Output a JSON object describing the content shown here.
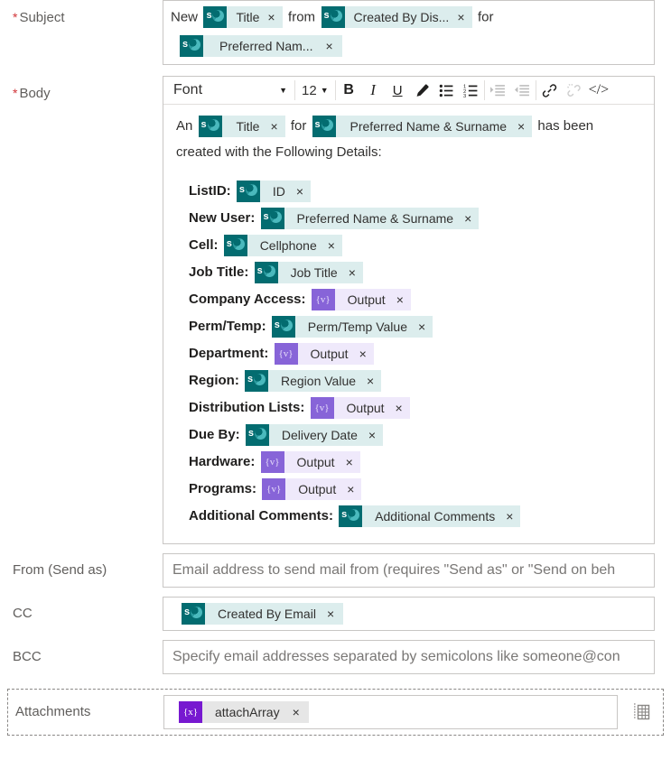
{
  "fields": {
    "subject_label": "Subject",
    "body_label": "Body",
    "from_label": "From (Send as)",
    "cc_label": "CC",
    "bcc_label": "BCC",
    "attachments_label": "Attachments",
    "required_marker": "*"
  },
  "subject": {
    "parts": [
      {
        "kind": "text",
        "text": "New"
      },
      {
        "kind": "token",
        "style": "sp",
        "icon": "sharepoint-icon",
        "label": "Title",
        "remove": "×"
      },
      {
        "kind": "text",
        "text": "from"
      },
      {
        "kind": "token",
        "style": "sp",
        "icon": "sharepoint-icon",
        "label": "Created By Dis...",
        "remove": "×"
      },
      {
        "kind": "text",
        "text": "for"
      },
      {
        "kind": "break"
      },
      {
        "kind": "token",
        "style": "sp",
        "icon": "sharepoint-icon",
        "label": "Preferred Nam...",
        "remove": "×"
      }
    ]
  },
  "editor_toolbar": {
    "font_name": "Font",
    "font_size": "12",
    "caret": "▼",
    "buttons": [
      {
        "name": "bold-button",
        "glyph": "B",
        "dim": false
      },
      {
        "name": "italic-button",
        "glyph": "I",
        "dim": false
      },
      {
        "name": "underline-button",
        "glyph": "U",
        "dim": false
      },
      {
        "name": "text-color-button",
        "glyph": "✒",
        "dim": false
      },
      {
        "name": "bulleted-list-button",
        "glyph": "☰",
        "dim": false
      },
      {
        "name": "numbered-list-button",
        "glyph": "☲",
        "dim": false
      },
      {
        "name": "indent-button",
        "glyph": "⇥",
        "dim": true
      },
      {
        "name": "outdent-button",
        "glyph": "⇤",
        "dim": true
      },
      {
        "name": "link-button",
        "glyph": "ὑ7",
        "dim": false
      },
      {
        "name": "unlink-button",
        "glyph": "⛓",
        "dim": true
      },
      {
        "name": "code-view-button",
        "glyph": "</>",
        "dim": false
      }
    ]
  },
  "body": {
    "intro": {
      "lead": "An",
      "title_token": {
        "style": "sp",
        "label": "Title",
        "remove": "×"
      },
      "mid": "for",
      "name_token": {
        "style": "sp",
        "label": "Preferred Name & Surname",
        "remove": "×"
      },
      "tail": "has been",
      "line2": "created with the Following Details:"
    },
    "details": [
      {
        "label": "ListID:",
        "style": "sp",
        "token": "ID",
        "remove": "×"
      },
      {
        "label": "New User:",
        "style": "sp",
        "token": "Preferred Name & Surname",
        "remove": "×"
      },
      {
        "label": "Cell:",
        "style": "sp",
        "token": "Cellphone",
        "remove": "×"
      },
      {
        "label": "Job Title:",
        "style": "sp",
        "token": "Job Title",
        "remove": "×"
      },
      {
        "label": "Company Access:",
        "style": "pa",
        "token": "Output",
        "remove": "×"
      },
      {
        "label": "Perm/Temp:",
        "style": "sp",
        "token": "Perm/Temp Value",
        "remove": "×"
      },
      {
        "label": "Department:",
        "style": "pa",
        "token": "Output",
        "remove": "×"
      },
      {
        "label": "Region:",
        "style": "sp",
        "token": "Region Value",
        "remove": "×"
      },
      {
        "label": "Distribution Lists:",
        "style": "pa",
        "token": "Output",
        "remove": "×"
      },
      {
        "label": "Due By:",
        "style": "sp",
        "token": "Delivery Date",
        "remove": "×"
      },
      {
        "label": "Hardware:",
        "style": "pa",
        "token": "Output",
        "remove": "×"
      },
      {
        "label": "Programs:",
        "style": "pa",
        "token": "Output",
        "remove": "×"
      },
      {
        "label": "Additional Comments:",
        "style": "sp",
        "token": "Additional Comments",
        "remove": "×"
      }
    ]
  },
  "from": {
    "value": "",
    "placeholder": "Email address to send mail from (requires \"Send as\" or \"Send on beh"
  },
  "cc": {
    "token": {
      "style": "sp",
      "icon": "sharepoint-icon",
      "label": "Created By Email",
      "remove": "×"
    }
  },
  "bcc": {
    "value": "",
    "placeholder": "Specify email addresses separated by semicolons like someone@con"
  },
  "attachments": {
    "token": {
      "style": "expr",
      "icon": "expression-icon",
      "label": "attachArray",
      "remove": "×"
    },
    "grid_icon": "table-view-icon"
  },
  "token_glyphs": {
    "sharepoint": "s",
    "variable": "{v}",
    "expression": "{x}"
  },
  "colors": {
    "sharepoint_teal": "#036c70",
    "sharepoint_body": "#dceded",
    "variable_purple": "#8764d8",
    "variable_body": "#efe9fb",
    "expression_purple": "#7719d0",
    "expression_body": "#e6e6e6",
    "required_red": "#d13438",
    "border": "#c8c6c4"
  }
}
